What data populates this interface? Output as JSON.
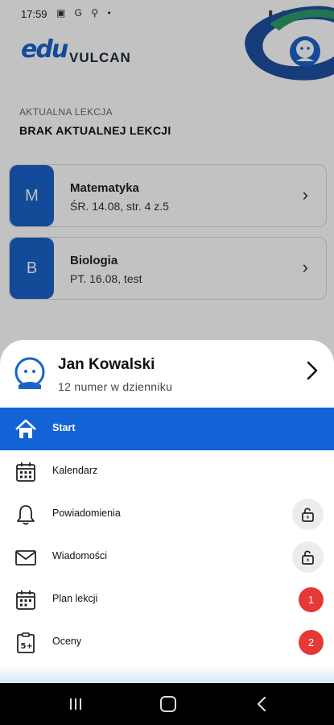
{
  "status_bar": {
    "time": "17:59",
    "left_icons": "▣ G ⚲ •",
    "right_icons": "▮ ◠ ▮ ▮"
  },
  "header": {
    "logo_mark": "edu",
    "brand": "VULCAN"
  },
  "current_lesson": {
    "label": "AKTUALNA LEKCJA",
    "value": "BRAK AKTUALNEJ LEKCJI"
  },
  "lessons": [
    {
      "letter": "M",
      "subject": "Matematyka",
      "detail": "ŚR. 14.08, str. 4 z.5"
    },
    {
      "letter": "B",
      "subject": "Biologia",
      "detail": "PT. 16.08, test"
    }
  ],
  "drawer": {
    "student_name": "Jan Kowalski",
    "student_sub": "12 numer w dzienniku",
    "items": [
      {
        "label": "Start",
        "icon": "home-icon",
        "active": true
      },
      {
        "label": "Kalendarz",
        "icon": "calendar-icon"
      },
      {
        "label": "Powiadomienia",
        "icon": "bell-icon",
        "locked": true
      },
      {
        "label": "Wiadomości",
        "icon": "envelope-icon",
        "locked": true
      },
      {
        "label": "Plan lekcji",
        "icon": "calendar-grid-icon",
        "badge": "1"
      },
      {
        "label": "Oceny",
        "icon": "grade-icon",
        "badge": "2"
      }
    ]
  },
  "colors": {
    "accent": "#1163d6",
    "brand_blue": "#1b63c9",
    "badge_red": "#e53935"
  }
}
